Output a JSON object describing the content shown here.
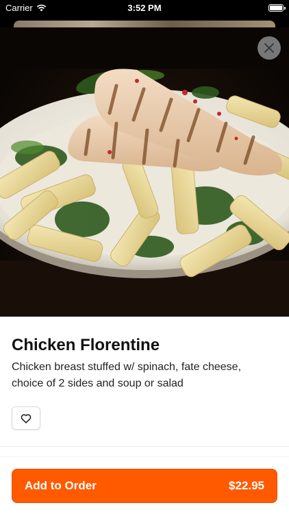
{
  "status_bar": {
    "carrier": "Carrier",
    "time": "3:52 PM"
  },
  "item": {
    "title": "Chicken Florentine",
    "description": "Chicken breast stuffed w/ spinach, fate cheese, choice of 2 sides and soup or salad"
  },
  "order": {
    "label": "Add to Order",
    "price": "$22.95"
  },
  "icons": {
    "close": "close-icon",
    "favorite": "heart-icon",
    "wifi": "wifi-icon",
    "battery": "battery-icon"
  },
  "colors": {
    "accent": "#ff5a00"
  }
}
